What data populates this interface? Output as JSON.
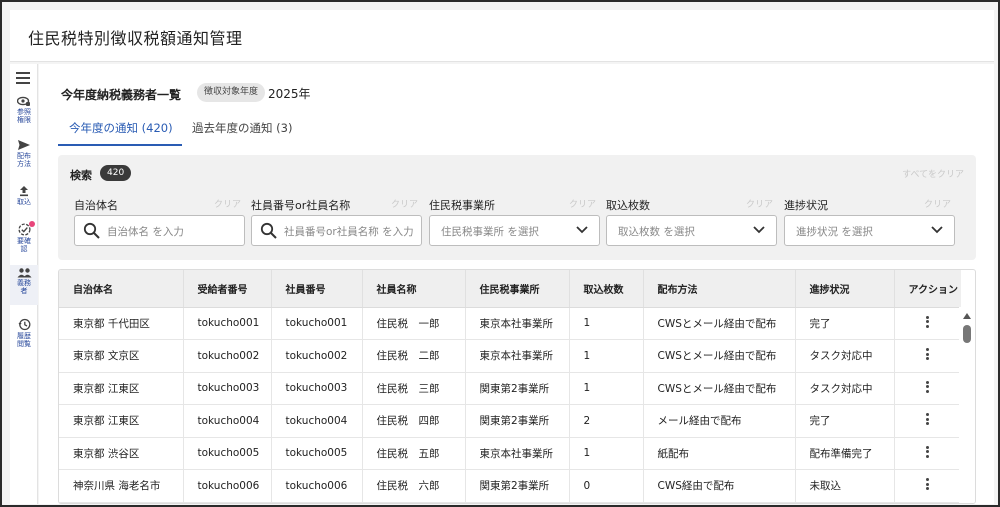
{
  "app": {
    "title": "住民税特別徴収税額通知管理"
  },
  "sidebar": {
    "items": [
      {
        "label": "参照\n権限",
        "icon": "eye-key-icon"
      },
      {
        "label": "配布\n方法",
        "icon": "send-icon"
      },
      {
        "label": "取込",
        "icon": "upload-icon"
      },
      {
        "label": "要確\n認",
        "icon": "check-circle-icon"
      },
      {
        "label": "義務\n者",
        "icon": "people-icon"
      },
      {
        "label": "履歴\n閲覧",
        "icon": "history-icon"
      }
    ]
  },
  "page": {
    "title": "今年度納税義務者一覧",
    "year_chip": "徴収対象年度",
    "year_value": "2025年"
  },
  "tabs": [
    {
      "label": "今年度の通知 (420)",
      "active": true
    },
    {
      "label": "過去年度の通知 (3)",
      "active": false
    }
  ],
  "search": {
    "label": "検索",
    "count": "420",
    "clear_all": "すべてをクリア",
    "fields": [
      {
        "label": "自治体名",
        "clear": "クリア",
        "placeholder": "自治体名 を入力"
      },
      {
        "label": "社員番号or社員名称",
        "clear": "クリア",
        "placeholder": "社員番号or社員名称 を入力"
      },
      {
        "label": "住民税事業所",
        "clear": "クリア",
        "placeholder": "住民税事業所 を選択"
      },
      {
        "label": "取込枚数",
        "clear": "クリア",
        "placeholder": "取込枚数 を選択"
      },
      {
        "label": "進捗状況",
        "clear": "クリア",
        "placeholder": "進捗状況 を選択"
      }
    ]
  },
  "table": {
    "columns": [
      "自治体名",
      "受給者番号",
      "社員番号",
      "社員名称",
      "住民税事業所",
      "取込枚数",
      "配布方法",
      "進捗状況",
      "アクション"
    ],
    "rows": [
      [
        "東京都 千代田区",
        "tokucho001",
        "tokucho001",
        "住民税　一郎",
        "東京本社事業所",
        "1",
        "CWSとメール経由で配布",
        "完了"
      ],
      [
        "東京都 文京区",
        "tokucho002",
        "tokucho002",
        "住民税　二郎",
        "東京本社事業所",
        "1",
        "CWSとメール経由で配布",
        "タスク対応中"
      ],
      [
        "東京都 江東区",
        "tokucho003",
        "tokucho003",
        "住民税　三郎",
        "関東第2事業所",
        "1",
        "CWSとメール経由で配布",
        "タスク対応中"
      ],
      [
        "東京都 江東区",
        "tokucho004",
        "tokucho004",
        "住民税　四郎",
        "関東第2事業所",
        "2",
        "メール経由で配布",
        "完了"
      ],
      [
        "東京都 渋谷区",
        "tokucho005",
        "tokucho005",
        "住民税　五郎",
        "東京本社事業所",
        "1",
        "紙配布",
        "配布準備完了"
      ],
      [
        "神奈川県 海老名市",
        "tokucho006",
        "tokucho006",
        "住民税　六郎",
        "関東第2事業所",
        "0",
        "CWS経由で配布",
        "未取込"
      ]
    ]
  }
}
